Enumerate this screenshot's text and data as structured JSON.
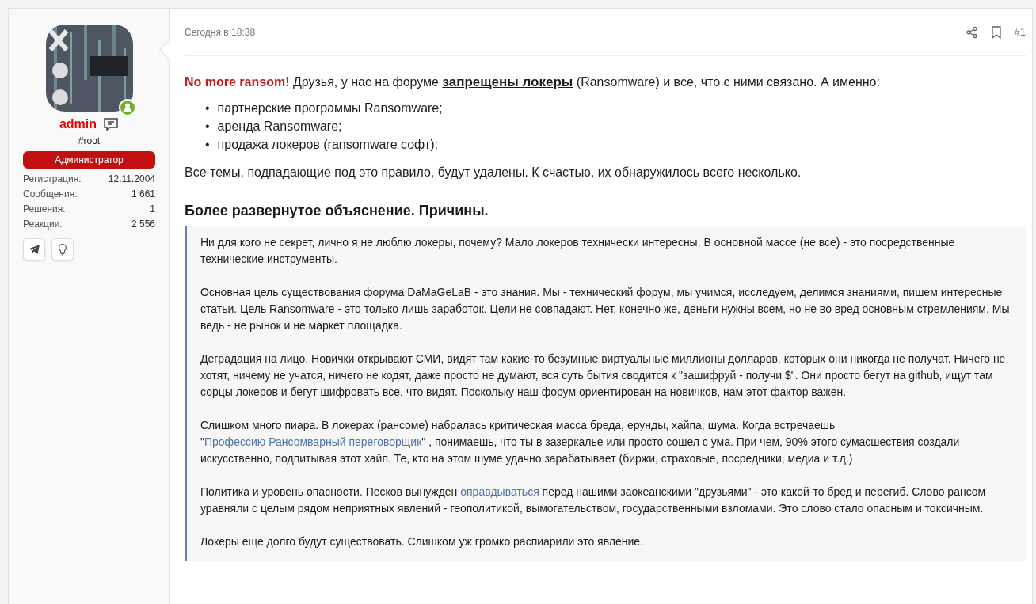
{
  "user": {
    "name": "admin",
    "online": true,
    "title": "#root",
    "banner": "Администратор",
    "stats": [
      {
        "label": "Регистрация:",
        "value": "12.11.2004"
      },
      {
        "label": "Сообщения:",
        "value": "1 661"
      },
      {
        "label": "Решения:",
        "value": "1"
      },
      {
        "label": "Реакции:",
        "value": "2 556"
      }
    ],
    "contacts": [
      {
        "kind": "telegram"
      },
      {
        "kind": "idea"
      }
    ]
  },
  "post": {
    "date": "Сегодня в 18:38",
    "number": "#1",
    "intro": [
      {
        "kind": "accent",
        "text": "No more ransom!"
      },
      {
        "kind": "text",
        "text": " Друзья, у нас на форуме "
      },
      {
        "kind": "strong",
        "text": "запрещены локеры"
      },
      {
        "kind": "text",
        "text": " (Ransomware) и все, что с ними связано. А именно:"
      }
    ],
    "list": [
      {
        "marker": "•",
        "text": "партнерские программы Ransomware;"
      },
      {
        "marker": "•",
        "text": "аренда Ransomware;"
      },
      {
        "marker": "•",
        "text": "продажа локеров (ransomware софт);"
      }
    ],
    "closing": "Все темы, подпадающие под это правило, будут удалены. К счастью, их обнаружилось всего несколько.",
    "heading": "Более развернутое объяснение. Причины.",
    "quote": [
      [
        {
          "kind": "text",
          "text": "Ни для кого не секрет, лично я не люблю локеры, почему? Мало локеров технически интересны. В основной массе (не все) - это посредственные технические инструменты."
        }
      ],
      [
        {
          "kind": "text",
          "text": "Основная цель существования форума DaMaGeLaB - это знания. Мы - технический форум, мы учимся, исследуем, делимся знаниями, пишем интересные статьи. Цель Ransomware - это только лишь заработок. Цели не совпадают. Нет, конечно же, деньги нужны всем, но не во вред основным стремлениям. Мы ведь - не рынок и не маркет площадка."
        }
      ],
      [
        {
          "kind": "text",
          "text": "Деградация на лицо. Новички открывают СМИ, видят там какие-то безумные виртуальные миллионы долларов, которых они никогда не получат. Ничего не хотят, ничему не учатся, ничего не кодят, даже просто не думают, вся суть бытия сводится к \"зашифруй - получи $\". Они просто бегут на github, ищут там сорцы локеров и бегут шифровать все, что видят. Поскольку наш форум ориентирован на новичков, нам этот фактор важен."
        }
      ],
      [
        {
          "kind": "text",
          "text": "Слишком много пиара. В локерах (рансоме) набралась критическая масса бреда, ерунды, хайпа, шума. Когда встречаешь \""
        },
        {
          "kind": "link",
          "text": "Профессию Рансомварный переговорщик"
        },
        {
          "kind": "text",
          "text": "\" , понимаешь, что ты в зазеркалье или просто сошел с ума. При чем, 90% этого сумасшествия создали искусственно, подпитывая этот хайп. Те, кто на этом шуме удачно зарабатывает (биржи, страховые, посредники, медиа и т.д.)"
        }
      ],
      [
        {
          "kind": "text",
          "text": "Политика и уровень опасности. Песков вынужден "
        },
        {
          "kind": "link",
          "text": "оправдываться"
        },
        {
          "kind": "text",
          "text": " перед нашими заокеанскими \"друзьями\" - это какой-то бред и перегиб. Слово рансом уравняли с целым рядом неприятных явлений - геополитикой, вымогательством, государственными взломами. Это слово стало опасным и токсичным."
        }
      ],
      [
        {
          "kind": "text",
          "text": "Локеры еще долго будут существовать. Слишком уж громко распиарили это явление."
        }
      ]
    ]
  }
}
